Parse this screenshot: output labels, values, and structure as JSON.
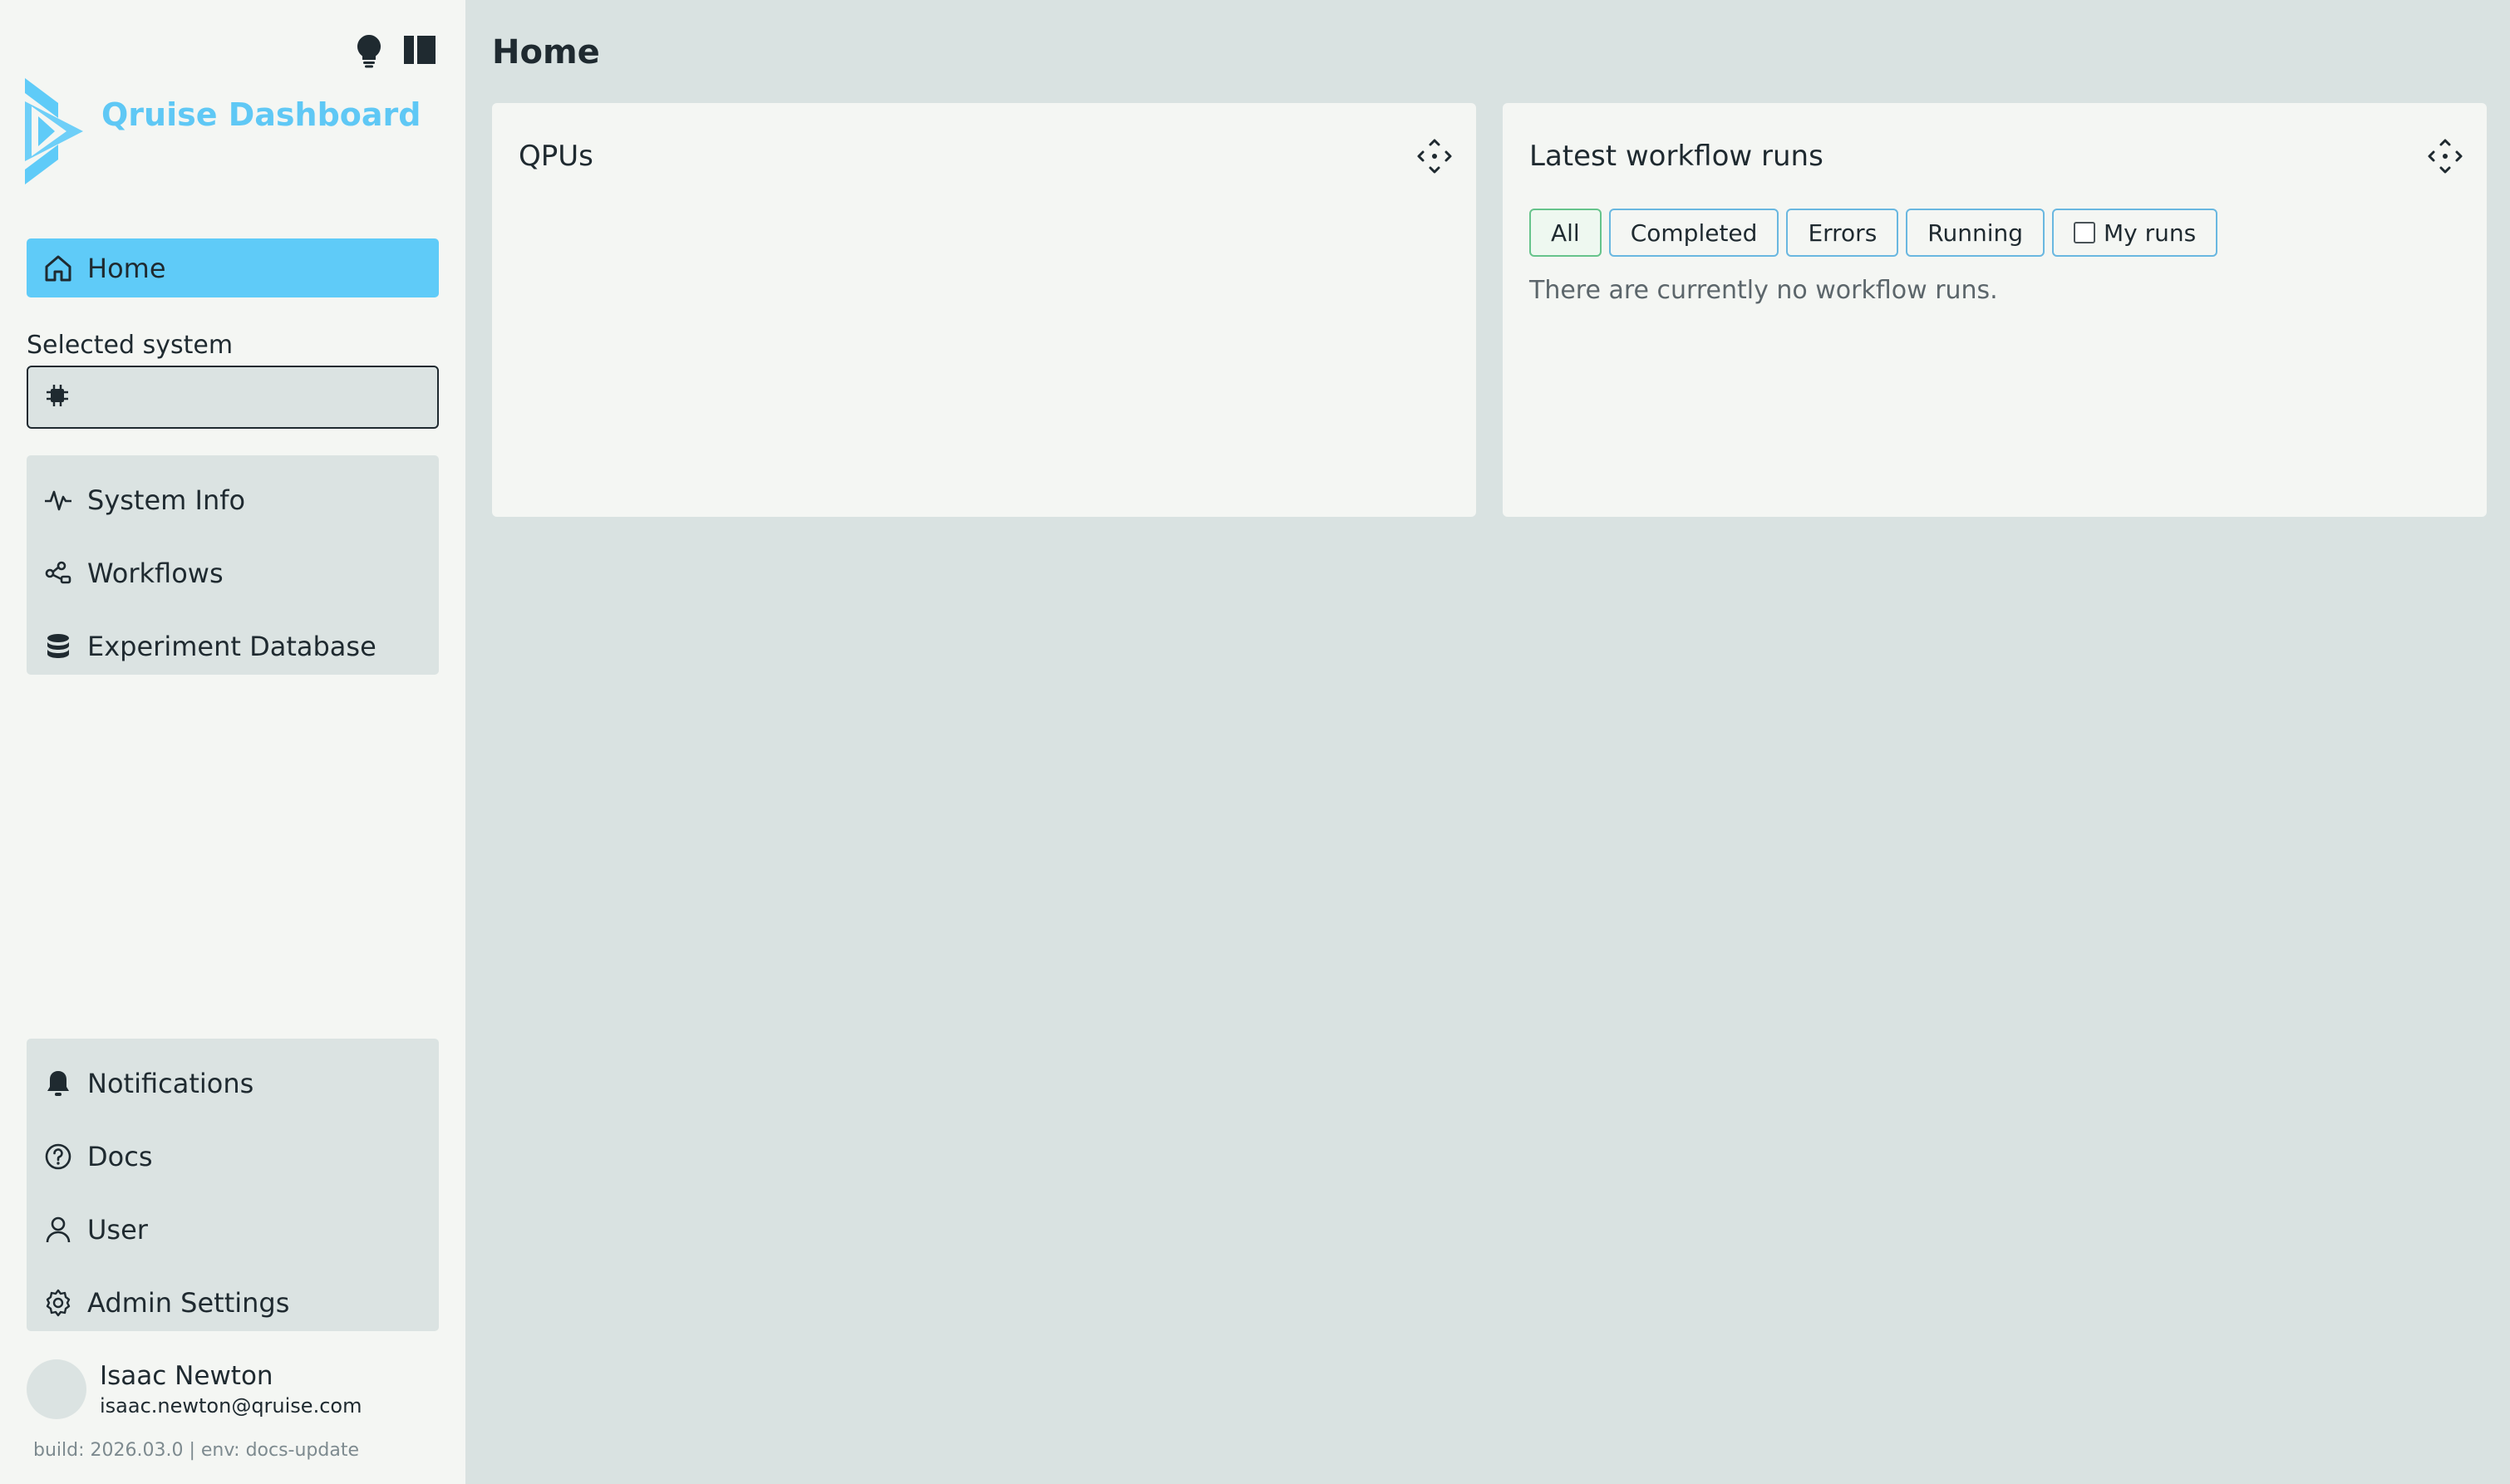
{
  "sidebar": {
    "brand": "Qruise Dashboard",
    "nav_home": "Home",
    "selected_system_label": "Selected system",
    "selected_system_value": "",
    "group1": [
      {
        "label": "System Info",
        "icon": "activity-icon"
      },
      {
        "label": "Workflows",
        "icon": "workflow-icon"
      },
      {
        "label": "Experiment Database",
        "icon": "database-icon"
      }
    ],
    "group2": [
      {
        "label": "Notifications",
        "icon": "bell-icon"
      },
      {
        "label": "Docs",
        "icon": "help-circle-icon"
      },
      {
        "label": "User",
        "icon": "user-icon"
      },
      {
        "label": "Admin Settings",
        "icon": "gear-icon"
      }
    ],
    "user": {
      "name": "Isaac Newton",
      "email": "isaac.newton@qruise.com"
    },
    "build": "build: 2026.03.0 | env: docs-update"
  },
  "main": {
    "title": "Home",
    "cards": {
      "qpus": {
        "title": "QPUs"
      },
      "runs": {
        "title": "Latest workflow runs",
        "filters": [
          "All",
          "Completed",
          "Errors",
          "Running"
        ],
        "my_runs_label": "My runs",
        "my_runs_checked": false,
        "empty_message": "There are currently no workflow runs."
      }
    }
  },
  "colors": {
    "accent": "#5fcbf8",
    "brand": "#5fc8f5",
    "sidebar_bg": "#f4f6f3",
    "main_bg": "#d9e2e1",
    "active_filter_border": "#66c38b",
    "filter_border": "#69b7e0"
  }
}
